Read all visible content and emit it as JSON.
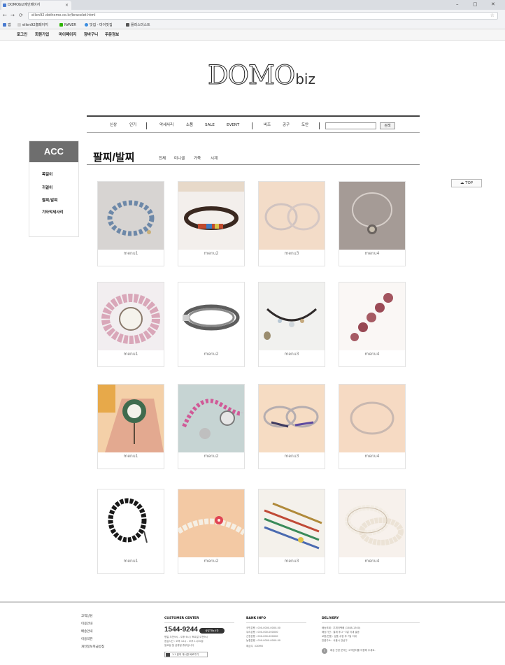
{
  "browser": {
    "tab_title": "DOMObiz메인페이지",
    "tab_close": "×",
    "url": "ellen92.dothome.co.kr/bracelet.html",
    "window_controls": [
      "–",
      "▢",
      "✕"
    ],
    "nav_back": "←",
    "nav_forward": "→",
    "nav_reload": "⟳",
    "star": "☆",
    "bookmarks": [
      "앱",
      "ellen92홈페이지",
      "NAVER",
      "맛집 - 마이맛집",
      "플러스미스트"
    ]
  },
  "site": {
    "top_links": [
      "로그인",
      "회원가입",
      "마이페이지",
      "장바구니",
      "주문정보"
    ],
    "logo_main": "DOMO",
    "logo_sub": "biz",
    "nav": {
      "group1": [
        "신상",
        "인기"
      ],
      "group2": [
        "악세사리",
        "소품",
        "SALE",
        "EVENT"
      ],
      "group3": [
        "비즈",
        "공구",
        "도안"
      ],
      "search_button": "검색"
    },
    "sidebar": {
      "title": "ACC",
      "items": [
        "목걸이",
        "귀걸이",
        "팔찌/발찌",
        "기타악세사리"
      ]
    },
    "category": {
      "title": "팔찌/발찌",
      "subtabs": [
        "전체",
        "미니셀",
        "가죽",
        "시계"
      ]
    },
    "top_button": "TOP"
  },
  "products": {
    "rows": [
      [
        "menu1",
        "menu2",
        "menu3",
        "menu4"
      ],
      [
        "menu1",
        "menu2",
        "menu3",
        "menu4"
      ],
      [
        "menu1",
        "menu2",
        "menu3",
        "menu4"
      ],
      [
        "menu1",
        "menu2",
        "menu3",
        "menu4"
      ]
    ]
  },
  "footer": {
    "links": [
      "고객상담",
      "이용안내",
      "배송안내",
      "이용약관",
      "개인정보취급방침"
    ],
    "customer": {
      "title": "CUSTOMER CENTER",
      "phone": "1544-9244",
      "badge": "상담가능시간",
      "lines": [
        "평일 오전9시 - 오후 6시 / 토요일 오전9시",
        "점심시간 : 오후 12시 - 오후 1시30분",
        "일요일 및 공휴일 휴무입니다"
      ],
      "button": "1:1 문의 게시판 바로가기"
    },
    "bank": {
      "title": "BANK INFO",
      "lines": [
        "국민은행 : 000-0000-0000-00",
        "우리은행 : 000-000-000000",
        "신한은행 : 000-000-000000",
        "농협은행 : 000-0000-0000-00",
        "예금주 : DOMO"
      ]
    },
    "delivery": {
      "title": "DELIVERY",
      "lines": [
        "배송조회 : 우체국택배 (1588-1300)",
        "배송기간 : 결제 후 2~3일 이내 발송",
        "교환/반품 : 상품 수령 후 7일 이내",
        "반품주소 : 서울시 강남구"
      ],
      "notice": "배송 관련 문의는 고객센터를 이용해 주세요."
    }
  },
  "colors": {
    "sidebar_head": "#6e6e6e",
    "nav_border": "#444444",
    "footer_rule": "#cccccc"
  }
}
